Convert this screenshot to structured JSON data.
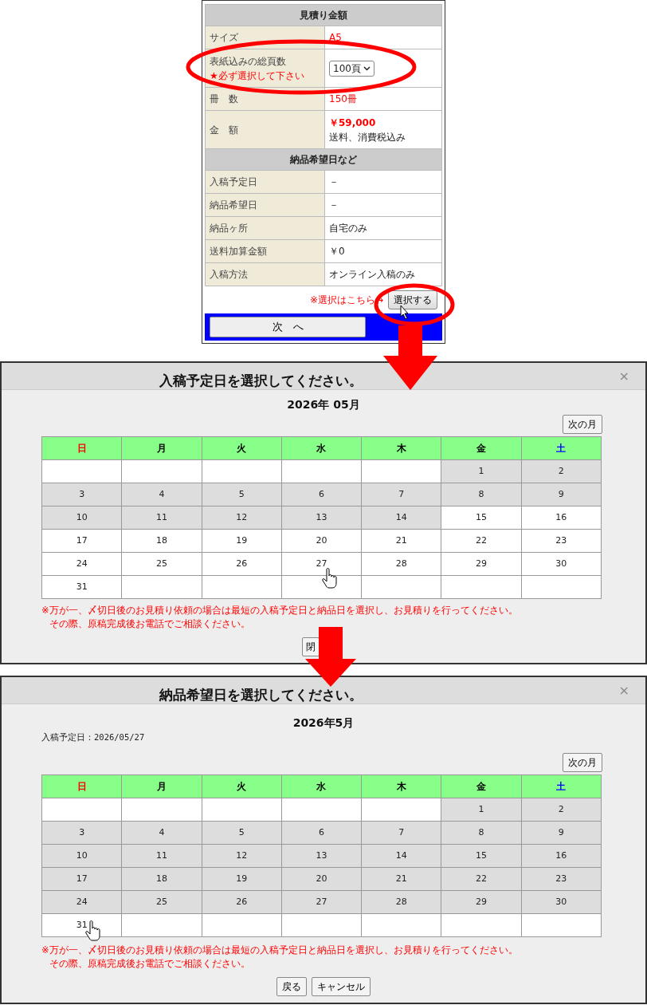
{
  "quote_form": {
    "sections": [
      {
        "title": "見積り金額",
        "rows": [
          {
            "label": "サイズ",
            "kind": "red",
            "value": "A5"
          },
          {
            "label": "表紙込みの総頁数",
            "note": "★必ず選択して下さい",
            "kind": "select",
            "value": "100頁"
          },
          {
            "label": "冊　数",
            "kind": "red",
            "value": "150冊"
          },
          {
            "label": "金　額",
            "kind": "price",
            "value": "￥59,000",
            "sub": "送料、消費税込み"
          }
        ]
      },
      {
        "title": "納品希望日など",
        "rows": [
          {
            "label": "入稿予定日",
            "kind": "plain",
            "value": "－"
          },
          {
            "label": "納品希望日",
            "kind": "plain",
            "value": "－"
          },
          {
            "label": "納品ヶ所",
            "kind": "plain",
            "value": "自宅のみ"
          },
          {
            "label": "送料加算金額",
            "kind": "plain",
            "value": "￥0"
          },
          {
            "label": "入稿方法",
            "kind": "plain",
            "value": "オンライン入稿のみ"
          }
        ]
      }
    ],
    "select_hint": "※選択はこちら→",
    "select_button": "選択する",
    "next_button": "次　へ"
  },
  "dialogs": [
    {
      "title": "入稿予定日を選択してください。",
      "close": "×",
      "month": "2026年 05月",
      "next_month": "次の月",
      "weekdays": [
        {
          "label": "日",
          "color": "#ff0000"
        },
        {
          "label": "月",
          "color": "#000000"
        },
        {
          "label": "火",
          "color": "#000000"
        },
        {
          "label": "水",
          "color": "#000000"
        },
        {
          "label": "木",
          "color": "#000000"
        },
        {
          "label": "金",
          "color": "#000000"
        },
        {
          "label": "土",
          "color": "#0000ff"
        }
      ],
      "weeks": [
        [
          {
            "kind": "blank"
          },
          {
            "kind": "blank"
          },
          {
            "kind": "blank"
          },
          {
            "kind": "blank"
          },
          {
            "kind": "blank"
          },
          {
            "kind": "day",
            "day": "1",
            "available": false
          },
          {
            "kind": "day",
            "day": "2",
            "available": false
          }
        ],
        [
          {
            "kind": "day",
            "day": "3",
            "available": false
          },
          {
            "kind": "day",
            "day": "4",
            "available": false
          },
          {
            "kind": "day",
            "day": "5",
            "available": false
          },
          {
            "kind": "day",
            "day": "6",
            "available": false
          },
          {
            "kind": "day",
            "day": "7",
            "available": false
          },
          {
            "kind": "day",
            "day": "8",
            "available": false
          },
          {
            "kind": "day",
            "day": "9",
            "available": false
          }
        ],
        [
          {
            "kind": "day",
            "day": "10",
            "available": false
          },
          {
            "kind": "day",
            "day": "11",
            "available": false
          },
          {
            "kind": "day",
            "day": "12",
            "available": false
          },
          {
            "kind": "day",
            "day": "13",
            "available": false
          },
          {
            "kind": "day",
            "day": "14",
            "available": false
          },
          {
            "kind": "day",
            "day": "15",
            "available": true
          },
          {
            "kind": "day",
            "day": "16",
            "available": true
          }
        ],
        [
          {
            "kind": "day",
            "day": "17",
            "available": true
          },
          {
            "kind": "day",
            "day": "18",
            "available": true
          },
          {
            "kind": "day",
            "day": "19",
            "available": true
          },
          {
            "kind": "day",
            "day": "20",
            "available": true
          },
          {
            "kind": "day",
            "day": "21",
            "available": true
          },
          {
            "kind": "day",
            "day": "22",
            "available": true
          },
          {
            "kind": "day",
            "day": "23",
            "available": true
          }
        ],
        [
          {
            "kind": "day",
            "day": "24",
            "available": true
          },
          {
            "kind": "day",
            "day": "25",
            "available": true
          },
          {
            "kind": "day",
            "day": "26",
            "available": true
          },
          {
            "kind": "day",
            "day": "27",
            "available": true
          },
          {
            "kind": "day",
            "day": "28",
            "available": true
          },
          {
            "kind": "day",
            "day": "29",
            "available": true
          },
          {
            "kind": "day",
            "day": "30",
            "available": true
          }
        ],
        [
          {
            "kind": "day",
            "day": "31",
            "available": true
          },
          {
            "kind": "blank"
          },
          {
            "kind": "blank"
          },
          {
            "kind": "blank"
          },
          {
            "kind": "blank"
          },
          {
            "kind": "blank"
          },
          {
            "kind": "blank"
          }
        ]
      ],
      "notes": [
        "※万が一、〆切日後のお見積り依頼の場合は最短の入稿予定日と納品日を選択し、お見積りを行ってください。",
        "その際、原稿完成後お電話でご相談ください。"
      ],
      "buttons": [
        "閉"
      ]
    },
    {
      "title": "納品希望日を選択してください。",
      "close": "×",
      "month": "2026年5月",
      "info": "入稿予定日：2026/05/27",
      "next_month": "次の月",
      "weekdays": [
        {
          "label": "日",
          "color": "#ff0000"
        },
        {
          "label": "月",
          "color": "#000000"
        },
        {
          "label": "火",
          "color": "#000000"
        },
        {
          "label": "水",
          "color": "#000000"
        },
        {
          "label": "木",
          "color": "#000000"
        },
        {
          "label": "金",
          "color": "#000000"
        },
        {
          "label": "土",
          "color": "#0000ff"
        }
      ],
      "weeks": [
        [
          {
            "kind": "blank"
          },
          {
            "kind": "blank"
          },
          {
            "kind": "blank"
          },
          {
            "kind": "blank"
          },
          {
            "kind": "blank"
          },
          {
            "kind": "day",
            "day": "1",
            "available": false
          },
          {
            "kind": "day",
            "day": "2",
            "available": false
          }
        ],
        [
          {
            "kind": "day",
            "day": "3",
            "available": false
          },
          {
            "kind": "day",
            "day": "4",
            "available": false
          },
          {
            "kind": "day",
            "day": "5",
            "available": false
          },
          {
            "kind": "day",
            "day": "6",
            "available": false
          },
          {
            "kind": "day",
            "day": "7",
            "available": false
          },
          {
            "kind": "day",
            "day": "8",
            "available": false
          },
          {
            "kind": "day",
            "day": "9",
            "available": false
          }
        ],
        [
          {
            "kind": "day",
            "day": "10",
            "available": false
          },
          {
            "kind": "day",
            "day": "11",
            "available": false
          },
          {
            "kind": "day",
            "day": "12",
            "available": false
          },
          {
            "kind": "day",
            "day": "13",
            "available": false
          },
          {
            "kind": "day",
            "day": "14",
            "available": false
          },
          {
            "kind": "day",
            "day": "15",
            "available": false
          },
          {
            "kind": "day",
            "day": "16",
            "available": false
          }
        ],
        [
          {
            "kind": "day",
            "day": "17",
            "available": false
          },
          {
            "kind": "day",
            "day": "18",
            "available": false
          },
          {
            "kind": "day",
            "day": "19",
            "available": false
          },
          {
            "kind": "day",
            "day": "20",
            "available": false
          },
          {
            "kind": "day",
            "day": "21",
            "available": false
          },
          {
            "kind": "day",
            "day": "22",
            "available": false
          },
          {
            "kind": "day",
            "day": "23",
            "available": false
          }
        ],
        [
          {
            "kind": "day",
            "day": "24",
            "available": false
          },
          {
            "kind": "day",
            "day": "25",
            "available": false
          },
          {
            "kind": "day",
            "day": "26",
            "available": false
          },
          {
            "kind": "day",
            "day": "27",
            "available": false
          },
          {
            "kind": "day",
            "day": "28",
            "available": false
          },
          {
            "kind": "day",
            "day": "29",
            "available": false
          },
          {
            "kind": "day",
            "day": "30",
            "available": false
          }
        ],
        [
          {
            "kind": "day",
            "day": "31",
            "available": true
          },
          {
            "kind": "blank"
          },
          {
            "kind": "blank"
          },
          {
            "kind": "blank"
          },
          {
            "kind": "blank"
          },
          {
            "kind": "blank"
          },
          {
            "kind": "blank"
          }
        ]
      ],
      "notes": [
        "※万が一、〆切日後のお見積り依頼の場合は最短の入稿予定日と納品日を選択し、お見積りを行ってください。",
        "その際、原稿完成後お電話でご相談ください。"
      ],
      "buttons": [
        "戻る",
        "キャンセル"
      ]
    }
  ]
}
